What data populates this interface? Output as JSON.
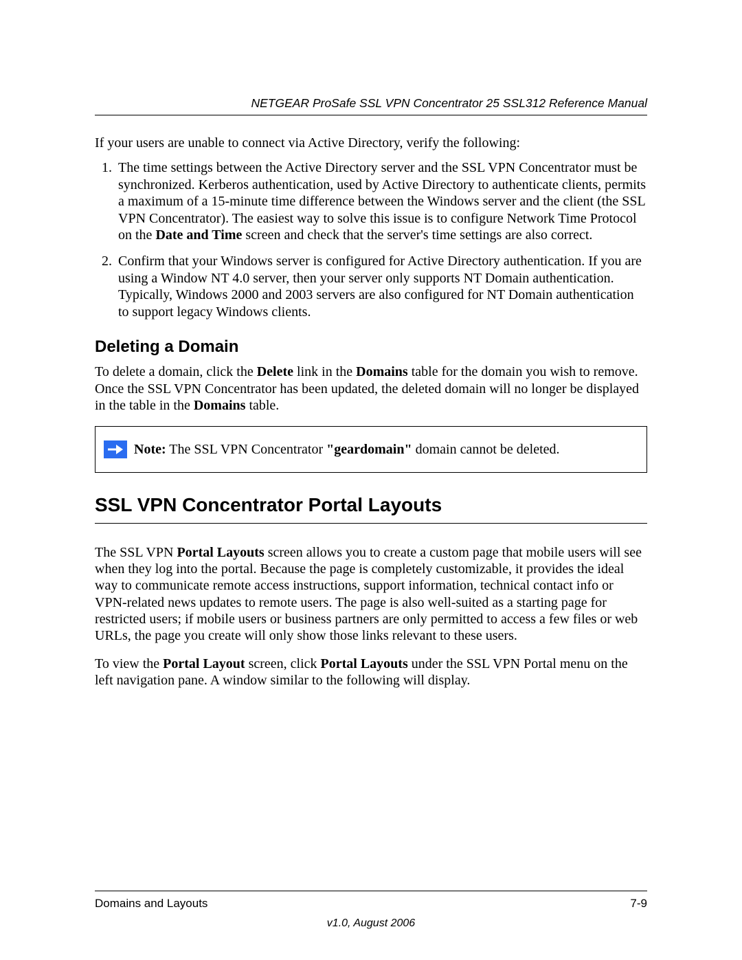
{
  "header": {
    "running_title": "NETGEAR ProSafe SSL VPN Concentrator 25 SSL312 Reference Manual"
  },
  "intro": "If your users are unable to connect via Active Directory, verify the following:",
  "list": {
    "item1_pre": "The time settings between the Active Directory server and the SSL VPN Concentrator must be synchronized. Kerberos authentication, used by Active Directory to authenticate clients, permits a maximum of a 15-minute time difference between the Windows server and the client (the SSL VPN Concentrator). The easiest way to solve this issue is to configure Network Time Protocol on the ",
    "item1_bold": "Date and Time",
    "item1_post": " screen and check that the server's time settings are also correct.",
    "item2": "Confirm that your Windows server is configured for Active Directory authentication. If you are using a Window NT 4.0 server, then your server only supports NT Domain authentication. Typically, Windows 2000 and 2003 servers are also configured for NT Domain authentication to support legacy Windows clients."
  },
  "section_delete": {
    "heading": "Deleting a Domain",
    "p1_a": "To delete a domain, click the ",
    "p1_delete": "Delete",
    "p1_b": " link in the ",
    "p1_domains1": "Domains",
    "p1_c": " table for the domain you wish to remove. Once the SSL VPN Concentrator has been updated, the deleted domain will no longer be displayed in the table in the ",
    "p1_domains2": "Domains",
    "p1_d": " table."
  },
  "note": {
    "label": "Note:",
    "t1": " The SSL VPN Concentrator ",
    "bold": "\"geardomain\"",
    "t2": " domain cannot be deleted."
  },
  "section_portal": {
    "heading": "SSL VPN Concentrator Portal Layouts",
    "p1_a": "The SSL VPN ",
    "p1_bold": "Portal Layouts",
    "p1_b": " screen allows you to create a custom page that mobile users will see when they log into the portal. Because the page is completely customizable, it provides the ideal way to communicate remote access instructions, support information, technical contact info or VPN-related news updates to remote users. The page is also well-suited as a starting page for restricted users; if mobile users or business partners are only permitted to access a few files or web URLs, the page you create will only show those links relevant to these users.",
    "p2_a": "To view the ",
    "p2_b1": "Portal Layout",
    "p2_b": " screen, click ",
    "p2_b2": "Portal Layouts",
    "p2_c": " under the SSL VPN Portal menu on the left navigation pane. A window similar to the following will display."
  },
  "footer": {
    "section": "Domains and Layouts",
    "pageno": "7-9",
    "version": "v1.0, August 2006"
  }
}
